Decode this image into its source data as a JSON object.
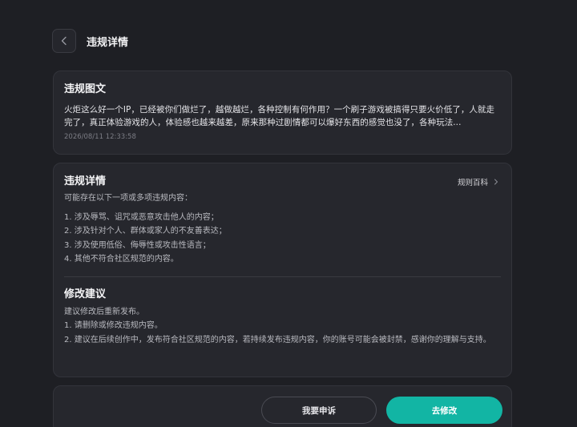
{
  "header": {
    "title": "违规详情"
  },
  "post": {
    "section_title": "违规图文",
    "body": "火炬这么好一个IP，已经被你们做烂了，越做越烂，各种控制有何作用？一个刷子游戏被搞得只要火价低了，人就走完了，真正体验游戏的人，体验感也越来越差，原来那种过剧情都可以爆好东西的感觉也没了，各种玩法...",
    "timestamp": "2026/08/11 12:33:58"
  },
  "detail": {
    "section_title": "违规详情",
    "rules_link": "规则百科",
    "intro": "可能存在以下一项或多项违规内容：",
    "items": [
      "1. 涉及辱骂、诅咒或恶意攻击他人的内容；",
      "2. 涉及针对个人、群体或家人的不友善表达；",
      "3. 涉及使用低俗、侮辱性或攻击性语言；",
      "4. 其他不符合社区规范的内容。"
    ]
  },
  "suggestion": {
    "section_title": "修改建议",
    "lines": [
      "建议修改后重新发布。",
      "1. 请删除或修改违规内容。",
      "2. 建议在后续创作中，发布符合社区规范的内容，若持续发布违规内容，你的账号可能会被封禁，感谢你的理解与支持。"
    ]
  },
  "actions": {
    "appeal_label": "我要申诉",
    "edit_label": "去修改"
  },
  "colors": {
    "background": "#1e1f24",
    "card": "#26272d",
    "accent": "#12b5a4"
  },
  "icons": {
    "back": "chevron-left-icon",
    "rules": "chevron-right-icon"
  }
}
